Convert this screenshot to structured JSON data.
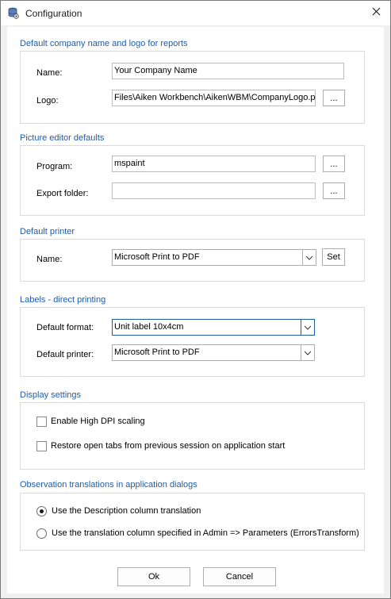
{
  "window": {
    "title": "Configuration",
    "app_icon": "database-settings-icon",
    "close_icon": "close-icon"
  },
  "company": {
    "section_title": "Default company name and logo for reports",
    "name_label": "Name:",
    "name_value": "Your Company Name",
    "logo_label": "Logo:",
    "logo_value": "Files\\Aiken Workbench\\AikenWBM\\CompanyLogo.png",
    "browse_label": "..."
  },
  "picture_editor": {
    "section_title": "Picture editor defaults",
    "program_label": "Program:",
    "program_value": "mspaint",
    "program_browse": "...",
    "export_label": "Export folder:",
    "export_value": "",
    "export_browse": "..."
  },
  "printer": {
    "section_title": "Default printer",
    "name_label": "Name:",
    "name_value": "Microsoft Print to PDF",
    "set_label": "Set"
  },
  "labels": {
    "section_title": "Labels - direct printing",
    "format_label": "Default format:",
    "format_value": "Unit label 10x4cm",
    "printer_label": "Default printer:",
    "printer_value": "Microsoft Print to PDF"
  },
  "display": {
    "section_title": "Display settings",
    "high_dpi_label": "Enable High DPI scaling",
    "high_dpi_checked": false,
    "restore_tabs_label": "Restore open tabs from previous session on application start",
    "restore_tabs_checked": false
  },
  "translations": {
    "section_title": "Observation translations in application dialogs",
    "option1_label": "Use the Description column translation",
    "option1_selected": true,
    "option2_label": "Use the translation column specified in Admin => Parameters (ErrorsTransform)",
    "option2_selected": false
  },
  "footer": {
    "ok_label": "Ok",
    "cancel_label": "Cancel"
  }
}
